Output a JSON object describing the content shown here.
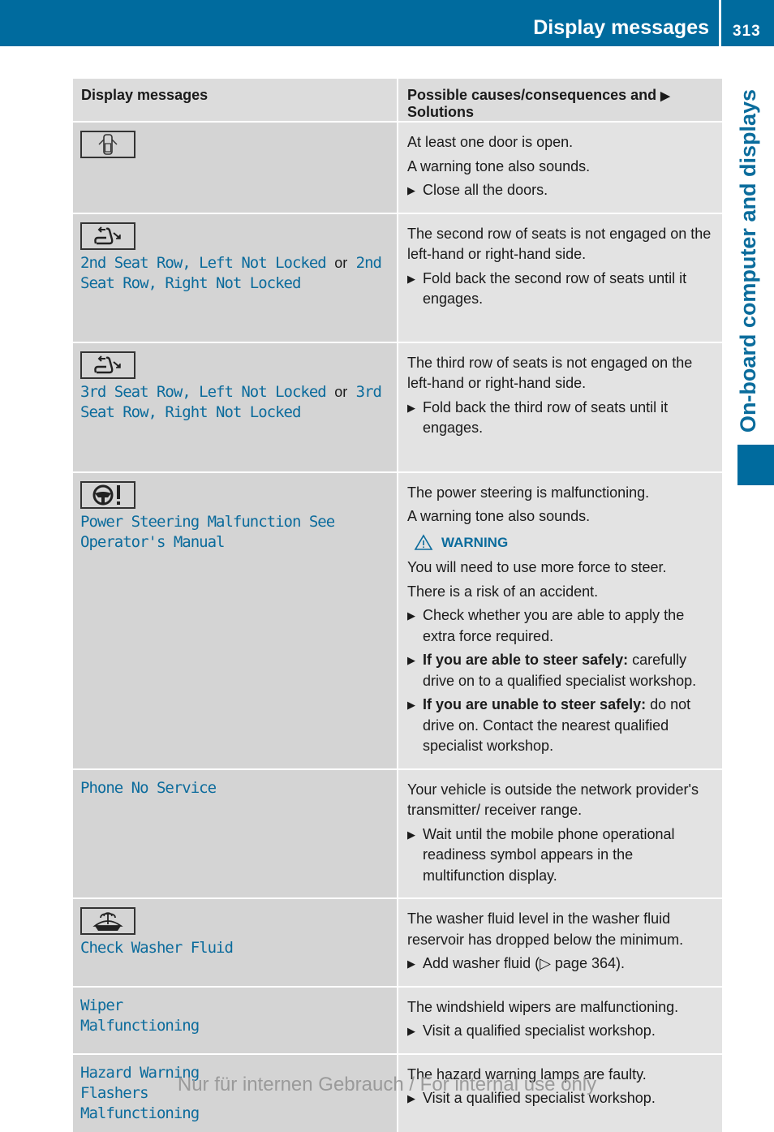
{
  "header": {
    "section_title": "Display messages",
    "page_number": "313"
  },
  "side_tab": {
    "label": "On-board computer and displays"
  },
  "table": {
    "headers": {
      "col1": "Display messages",
      "col2_prefix": "Possible causes/consequences and",
      "col2_arrow": "▶",
      "col2_suffix": "Solutions"
    },
    "rows": [
      {
        "icon": "door-open-icon",
        "messages": [],
        "texts": [
          "At least one door is open.",
          "A warning tone also sounds."
        ],
        "steps": [
          "Close all the doors."
        ]
      },
      {
        "icon": "seat-fold-icon",
        "message_parts": [
          "2nd Seat Row, Left Not Locked",
          "or",
          "2nd Seat Row, Right Not Locked"
        ],
        "texts": [
          "The second row of seats is not engaged on the left-hand or right-hand side."
        ],
        "steps": [
          "Fold back the second row of seats until it engages."
        ]
      },
      {
        "icon": "seat-fold-icon",
        "message_parts": [
          "3rd Seat Row, Left Not Locked",
          "or",
          "3rd Seat Row, Right Not Locked"
        ],
        "texts": [
          "The third row of seats is not engaged on the left-hand or right-hand side."
        ],
        "steps": [
          "Fold back the third row of seats until it engages."
        ]
      },
      {
        "icon": "steering-wheel-warning-icon",
        "message": "Power Steering Malfunction See Operator's Manual",
        "texts": [
          "The power steering is malfunctioning.",
          "A warning tone also sounds."
        ],
        "warning": {
          "label": "WARNING",
          "texts": [
            "You will need to use more force to steer.",
            "There is a risk of an accident."
          ]
        },
        "steps": [
          {
            "bold": "",
            "text": "Check whether you are able to apply the extra force required."
          },
          {
            "bold": "If you are able to steer safely:",
            "text": " carefully drive on to a qualified specialist workshop."
          },
          {
            "bold": "If you are unable to steer safely:",
            "text": " do not drive on. Contact the nearest qualified specialist workshop."
          }
        ]
      },
      {
        "message": "Phone No Service",
        "texts": [
          "Your vehicle is outside the network provider's transmitter/ receiver range."
        ],
        "steps": [
          "Wait until the mobile phone operational readiness symbol appears in the multifunction display."
        ]
      },
      {
        "icon": "washer-fluid-icon",
        "message": "Check Washer Fluid",
        "texts": [
          "The washer fluid level in the washer fluid reservoir has dropped below the minimum."
        ],
        "steps": [
          "Add washer fluid (▷ page 364)."
        ]
      },
      {
        "message": "Wiper Malfunctioning",
        "texts": [
          "The windshield wipers are malfunctioning."
        ],
        "steps": [
          "Visit a qualified specialist workshop."
        ]
      },
      {
        "message": "Hazard Warning Flashers Malfunctioning",
        "texts": [
          "The hazard warning lamps are faulty."
        ],
        "steps": [
          "Visit a qualified specialist workshop."
        ]
      }
    ]
  },
  "footer": {
    "watermark": "Nur für internen Gebrauch / For internal use only"
  },
  "colors": {
    "brand_blue": "#006b9e",
    "message_blue": "#0b6b9c"
  }
}
